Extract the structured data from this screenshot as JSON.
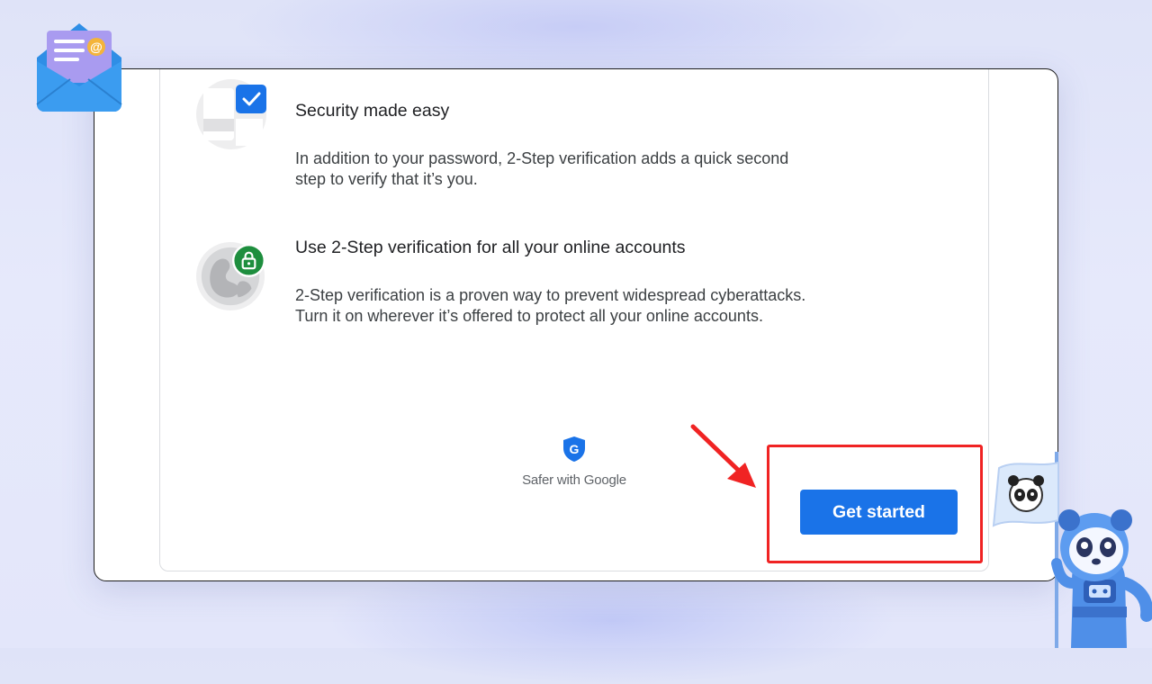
{
  "features": [
    {
      "title": "Security made easy",
      "description": "In addition to your password, 2-Step verification adds a quick second step to verify that it’s you.",
      "icon": "checkbox-illustration"
    },
    {
      "title": "Use 2-Step verification for all your online accounts",
      "description": "2-Step verification is a proven way to prevent widespread cyberattacks. Turn it on wherever it’s offered to protect all your online accounts.",
      "icon": "globe-lock-illustration"
    }
  ],
  "brand": {
    "shield_letter": "G",
    "text": "Safer with Google"
  },
  "primary_button": {
    "label": "Get started"
  },
  "colors": {
    "accent_blue": "#1a73e8",
    "highlight_red": "#f02323",
    "lock_green": "#1e8e3e"
  }
}
